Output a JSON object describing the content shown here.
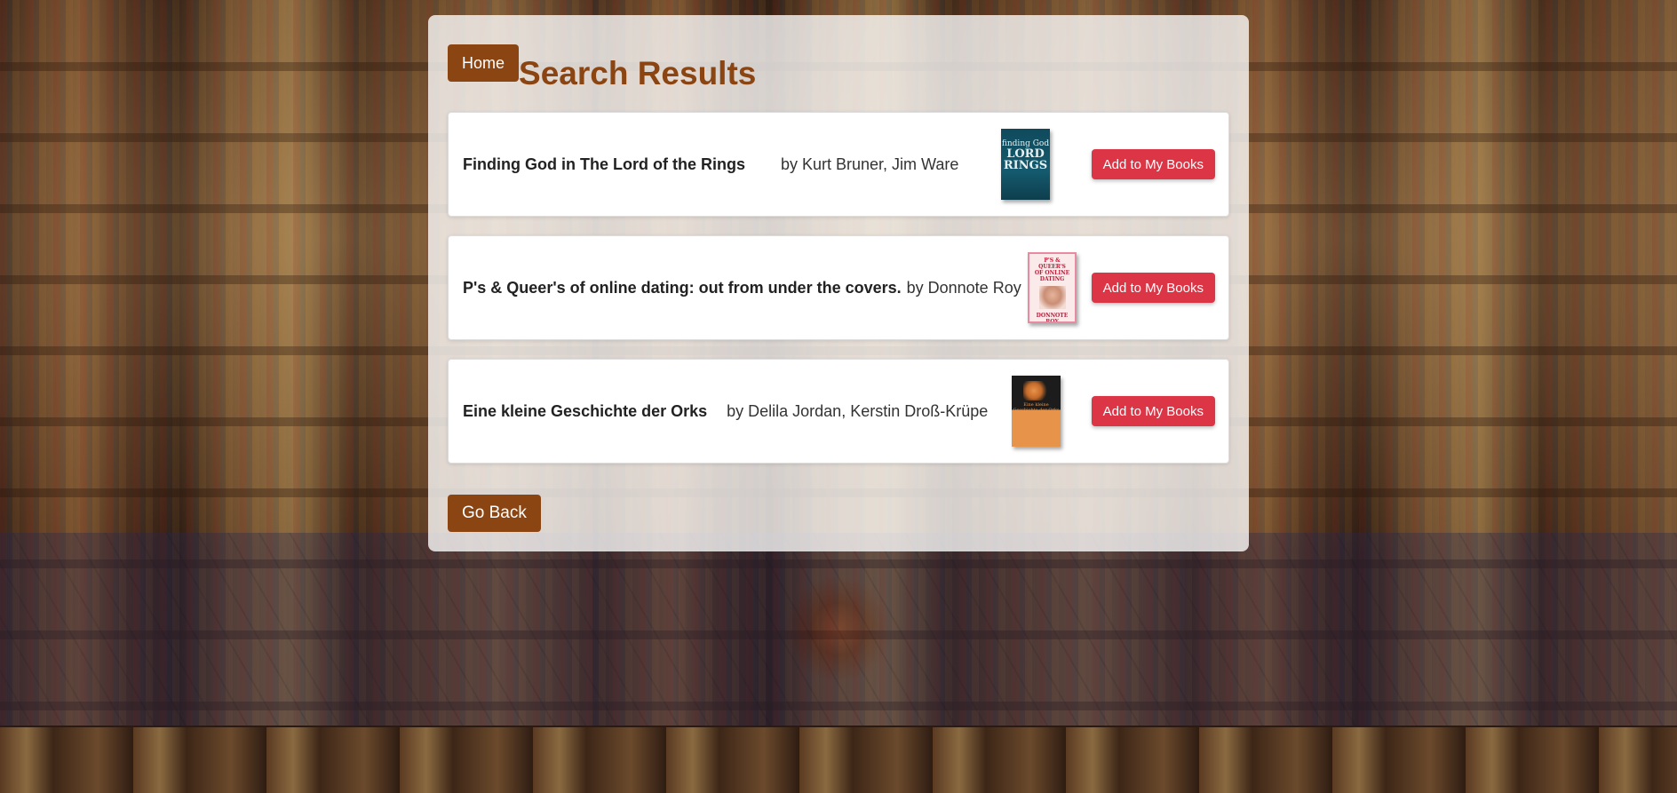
{
  "header": {
    "home_label": "Home",
    "title": "Search Results"
  },
  "results": [
    {
      "title": "Finding God in The Lord of the Rings",
      "author": "by Kurt Bruner, Jim Ware",
      "cover_text_top": "finding God",
      "cover_text_mid": "LORD",
      "cover_text_bottom": "RINGS",
      "add_label": "Add to My Books"
    },
    {
      "title": "P's & Queer's of online dating: out from under the covers.",
      "author": "by Donnote Roy",
      "cover_text_top": "P'S & QUEER'S",
      "cover_text_mid": "OF ONLINE DATING",
      "cover_text_bottom": "DONNOTE ROY",
      "add_label": "Add to My Books"
    },
    {
      "title": "Eine kleine Geschichte der Orks",
      "author": "by Delila Jordan, Kerstin Droß-Krüpe",
      "cover_text_top": "Eine kleine Geschichte der Orks",
      "add_label": "Add to My Books"
    }
  ],
  "footer": {
    "go_back_label": "Go Back"
  },
  "colors": {
    "brand_brown": "#8b4513",
    "danger_red": "#dc3545"
  },
  "icons": {
    "cover_1": "book-cover-image",
    "cover_2": "book-cover-image",
    "cover_3": "book-cover-image"
  }
}
